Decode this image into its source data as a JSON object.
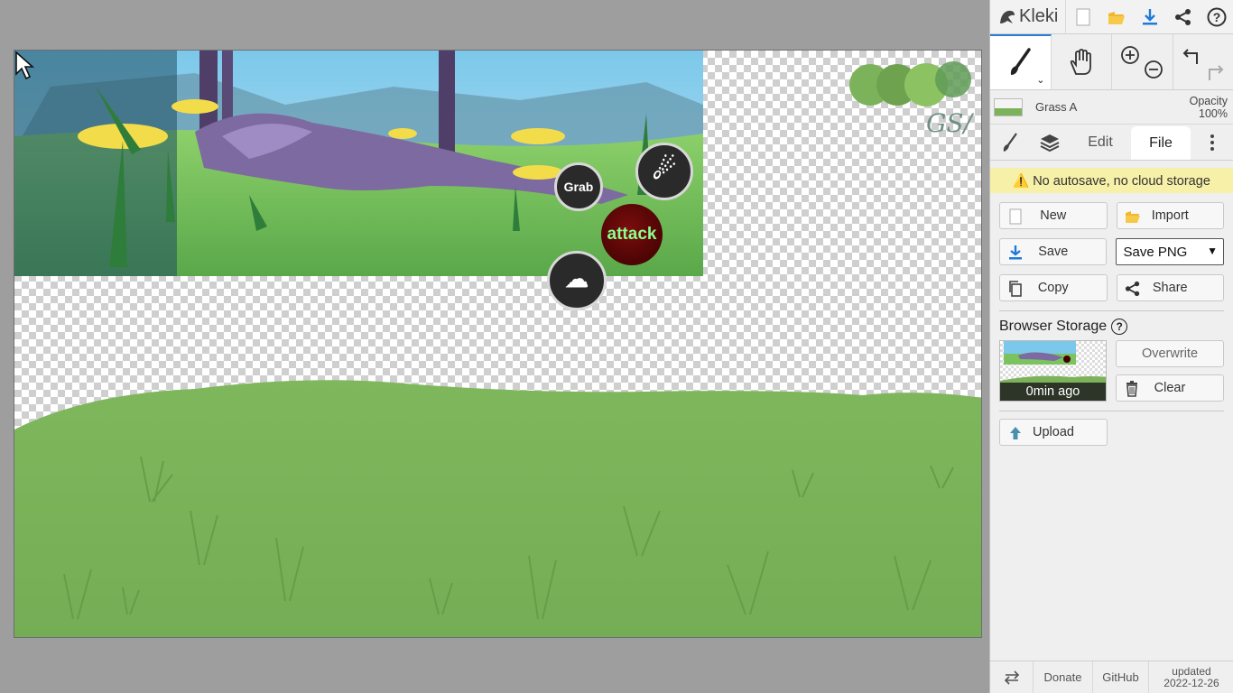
{
  "app": {
    "name": "Kleki"
  },
  "topbar": {
    "icons": [
      "new-file-icon",
      "open-folder-icon",
      "download-icon",
      "share-icon",
      "help-icon"
    ]
  },
  "tools": {
    "brush": "brush-icon",
    "hand": "hand-icon",
    "zoom_in": "zoom-in-icon",
    "zoom_out": "zoom-out-icon",
    "undo": "undo-icon",
    "redo": "redo-icon"
  },
  "layer": {
    "name": "Grass A",
    "opacity_label": "Opacity",
    "opacity_value": "100%"
  },
  "tabs": {
    "edit": "Edit",
    "file": "File"
  },
  "file_panel": {
    "warning": "⚠️ No autosave, no cloud storage",
    "new_label": "New",
    "import_label": "Import",
    "save_label": "Save",
    "save_format": "Save PNG",
    "copy_label": "Copy",
    "share_label": "Share",
    "storage_title": "Browser Storage",
    "storage_help": "?",
    "storage_time": "0min ago",
    "overwrite_label": "Overwrite",
    "clear_label": "Clear",
    "upload_label": "Upload"
  },
  "canvas": {
    "game_ui": {
      "grab": "Grab",
      "attack": "attack"
    },
    "signature": "GS/"
  },
  "footer": {
    "donate": "Donate",
    "github": "GitHub",
    "updated_label": "updated",
    "updated_date": "2022-12-26"
  },
  "colors": {
    "accent": "#2e7bd6",
    "warning_bg": "#f7f0a8",
    "grass": "#7cb35a"
  }
}
